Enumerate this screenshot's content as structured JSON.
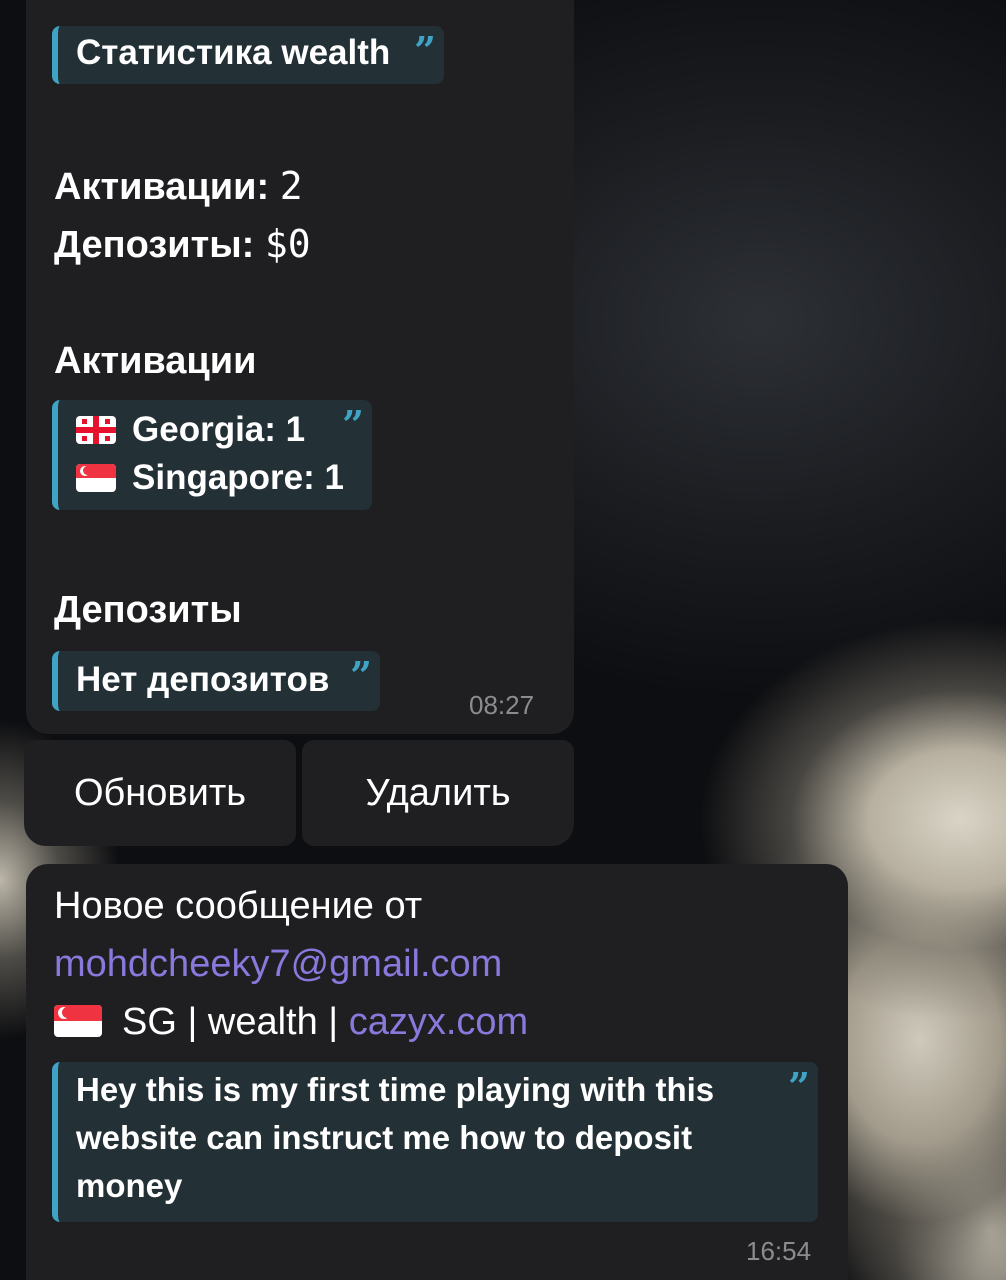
{
  "stats_message": {
    "title": "Статистика wealth",
    "activations_label": "Активации:",
    "activations_value": "2",
    "deposits_label": "Депозиты:",
    "deposits_value": "$0",
    "activations_heading": "Активации",
    "countries": [
      {
        "flag_icon": "georgia-flag-icon",
        "text": "Georgia: 1"
      },
      {
        "flag_icon": "singapore-flag-icon",
        "text": "Singapore: 1"
      }
    ],
    "deposits_heading": "Депозиты",
    "no_deposits": "Нет депозитов",
    "time": "08:27"
  },
  "inline_buttons": {
    "refresh": "Обновить",
    "delete": "Удалить"
  },
  "new_message": {
    "intro": "Новое сообщение от",
    "email": "mohdcheeky7@gmail.com",
    "flag_icon": "singapore-flag-icon",
    "source_prefix": "SG | wealth |",
    "site": "cazyx.com",
    "quote_lines": [
      "Hey this is my first time playing with this",
      "website can instruct me how to deposit",
      "money"
    ],
    "time": "16:54"
  },
  "colors": {
    "bubble": "#1f1f21",
    "quote_bg": "#233036",
    "quote_accent": "#3ea3c4",
    "link": "#8a78dc",
    "timestamp": "#8c8c90"
  }
}
